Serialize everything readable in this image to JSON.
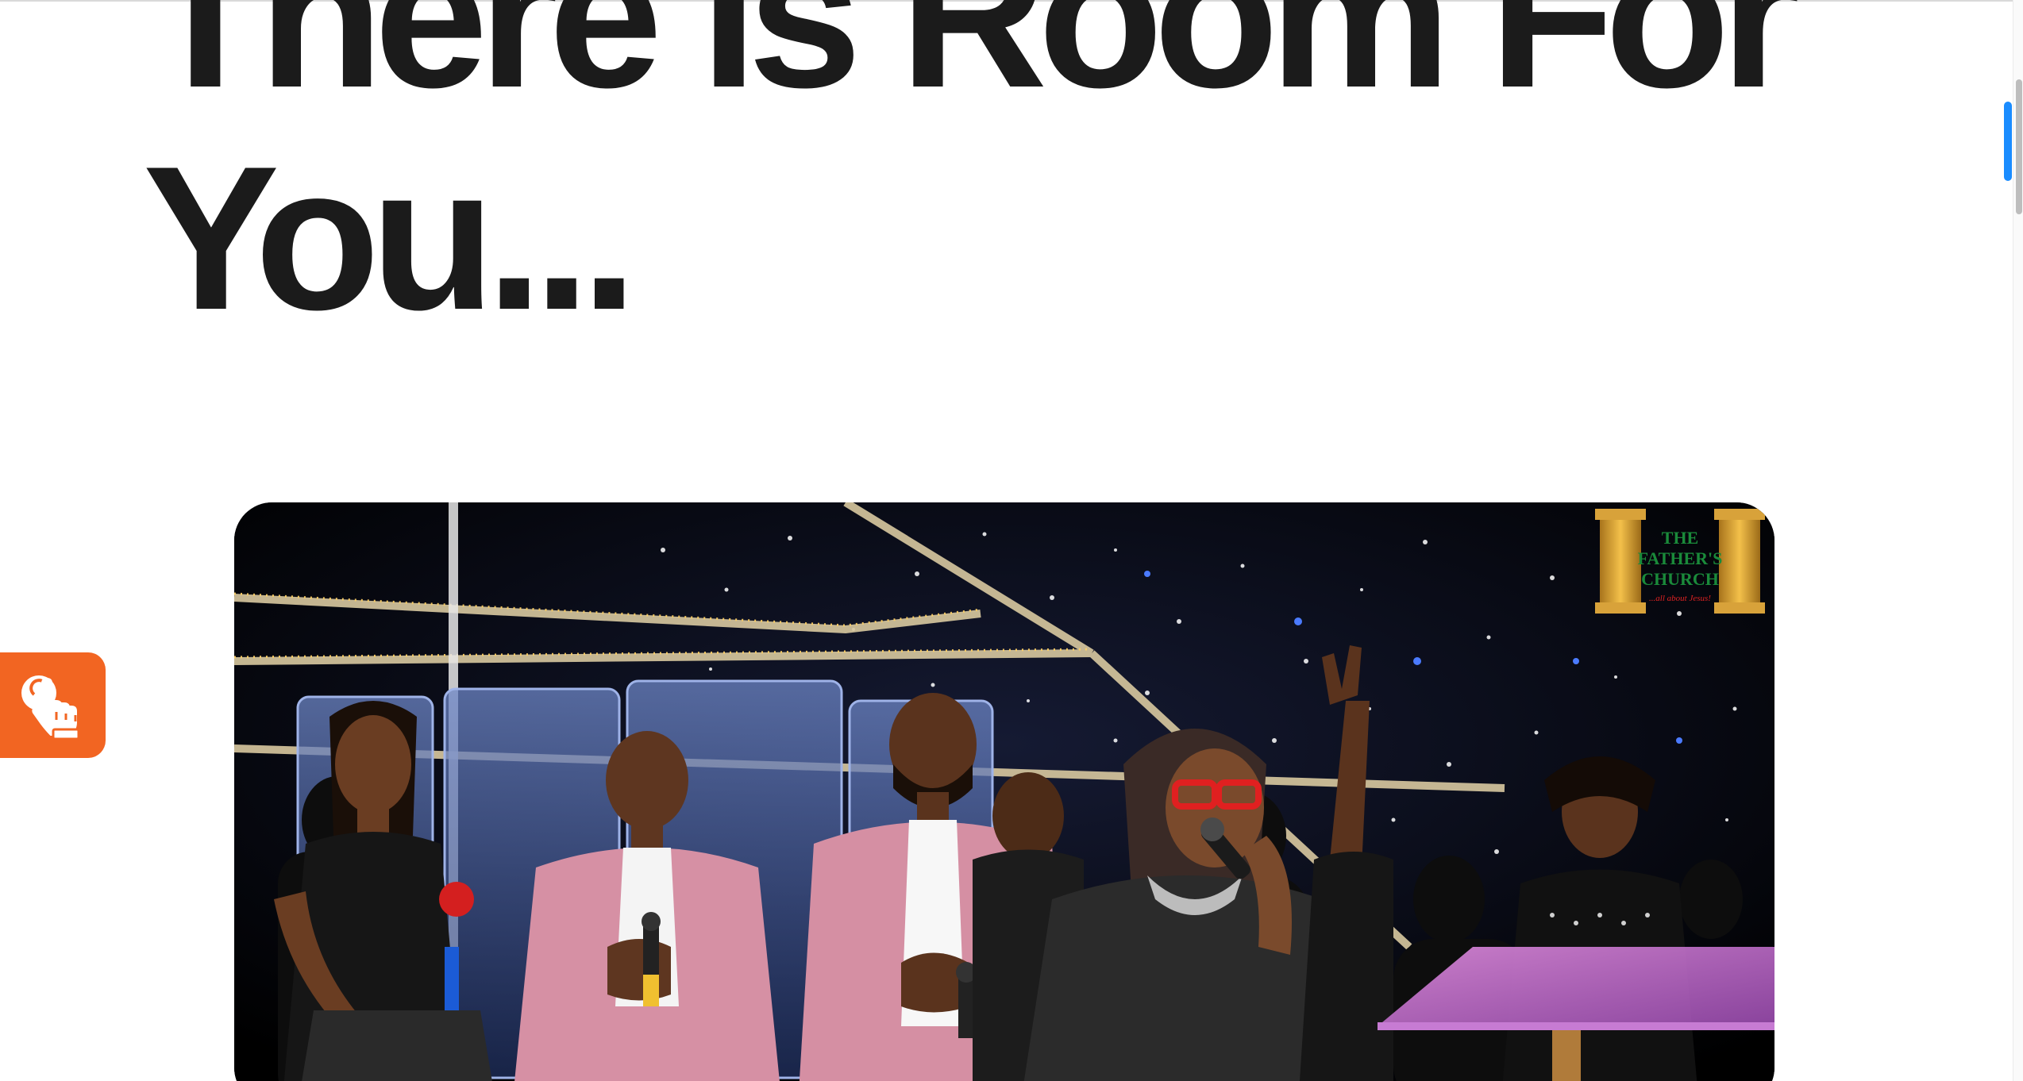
{
  "article": {
    "title": "There Is Room For You..."
  },
  "hero_image": {
    "watermark": {
      "line1": "THE",
      "line2": "FATHER'S",
      "line3": "CHURCH",
      "tagline": "...all about Jesus!"
    }
  },
  "accessibility_button": {
    "icon": "pointing-hand-icon",
    "color": "#f26522"
  },
  "colors": {
    "title": "#1b1b1b",
    "accent": "#f26522",
    "scroll_indicator": "#1a8cff"
  }
}
